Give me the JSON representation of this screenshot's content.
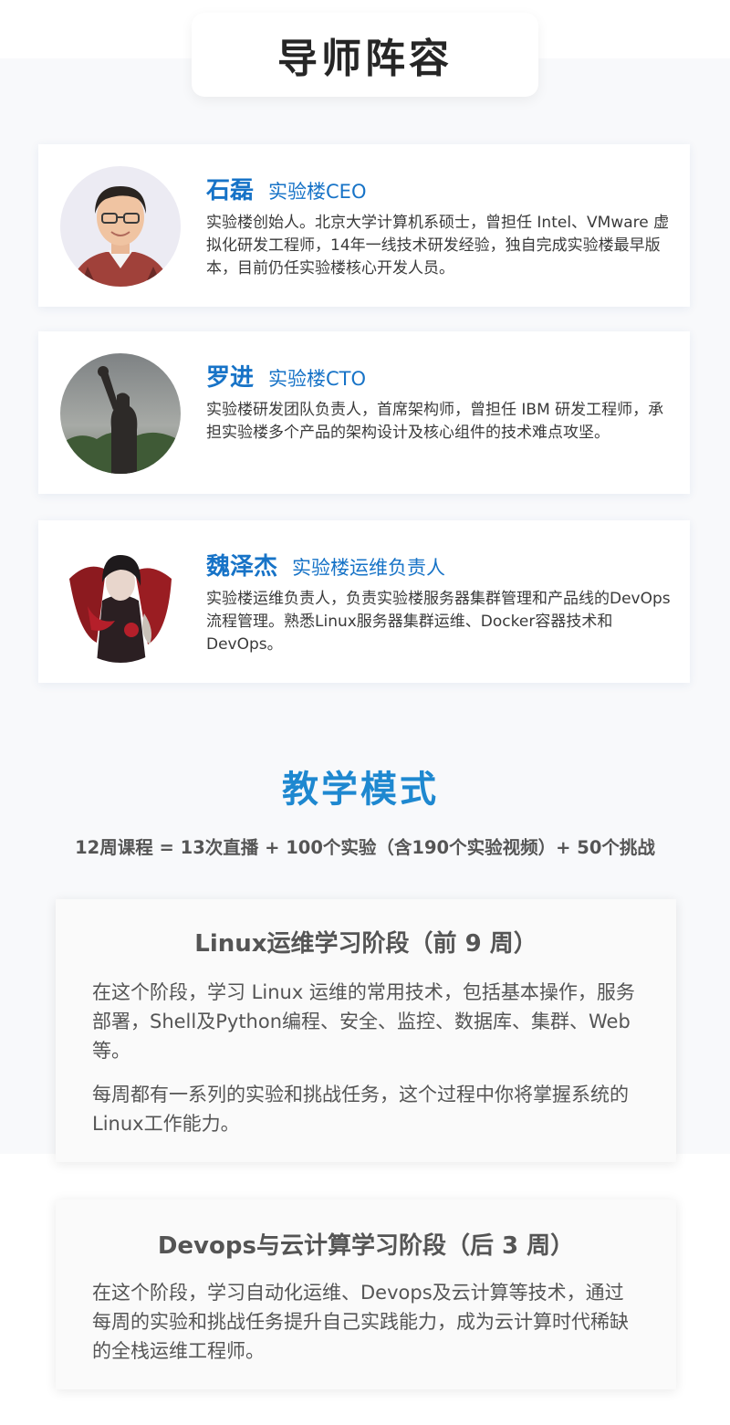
{
  "mentors_section": {
    "title": "导师阵容"
  },
  "mentors": [
    {
      "name": "石磊",
      "role": "实验楼CEO",
      "desc": "实验楼创始人。北京大学计算机系硕士，曾担任 Intel、VMware 虚拟化研发工程师，14年一线技术研发经验，独自完成实验楼最早版本，目前仍任实验楼核心开发人员。",
      "avatar": "person-glasses-portrait"
    },
    {
      "name": "罗进",
      "role": "实验楼CTO",
      "desc": "实验楼研发团队负责人，首席架构师，曾担任 IBM 研发工程师，承担实验楼多个产品的架构设计及核心组件的技术难点攻坚。",
      "avatar": "raised-fist-silhouette"
    },
    {
      "name": "魏泽杰",
      "role": "实验楼运维负责人",
      "desc": "实验楼运维负责人，负责实验楼服务器集群管理和产品线的DevOps流程管理。熟悉Linux服务器集群运维、Docker容器技术和DevOps。",
      "avatar": "anime-character-art"
    }
  ],
  "teaching": {
    "title": "教学模式",
    "formula": "12周课程 = 13次直播 + 100个实验（含190个实验视频）+ 50个挑战",
    "stages": [
      {
        "title": "Linux运维学习阶段（前 9 周）",
        "paragraphs": [
          "在这个阶段，学习 Linux 运维的常用技术，包括基本操作，服务部署，Shell及Python编程、安全、监控、数据库、集群、Web等。",
          "每周都有一系列的实验和挑战任务，这个过程中你将掌握系统的Linux工作能力。"
        ]
      },
      {
        "title": "Devops与云计算学习阶段（后 3 周）",
        "paragraphs": [
          "在这个阶段，学习自动化运维、Devops及云计算等技术，通过每周的实验和挑战任务提升自己实践能力，成为云计算时代稀缺的全栈运维工程师。"
        ]
      }
    ]
  },
  "colors": {
    "accent_blue": "#1773c7",
    "title_blue": "#1e88d0",
    "text_gray": "#555555"
  }
}
